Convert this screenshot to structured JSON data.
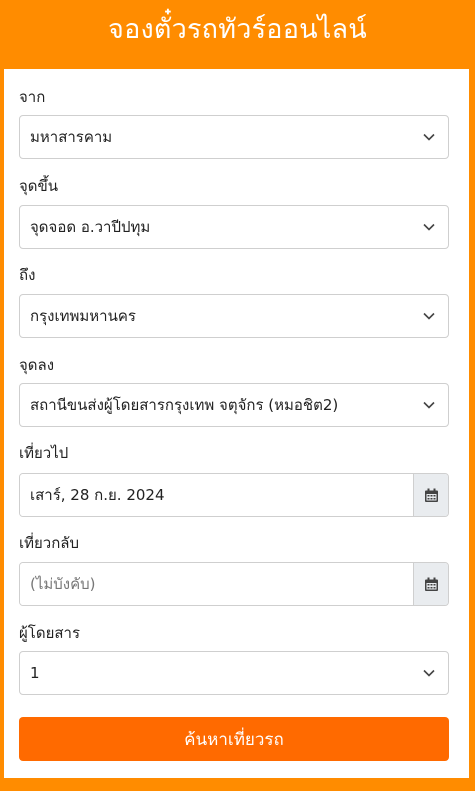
{
  "header": {
    "title": "จองตั๋วรถทัวร์ออนไลน์"
  },
  "form": {
    "origin": {
      "label": "จาก",
      "value": "มหาสารคาม"
    },
    "pickup": {
      "label": "จุดขึ้น",
      "value": "จุดจอด อ.วาปีปทุม"
    },
    "destination": {
      "label": "ถึง",
      "value": "กรุงเทพมหานคร"
    },
    "dropoff": {
      "label": "จุดลง",
      "value": "สถานีขนส่งผู้โดยสารกรุงเทพ จตุจักร (หมอชิต2)"
    },
    "depart": {
      "label": "เที่ยวไป",
      "value": "เสาร์, 28 ก.ย. 2024"
    },
    "return": {
      "label": "เที่ยวกลับ",
      "placeholder": "(ไม่บังคับ)"
    },
    "passengers": {
      "label": "ผู้โดยสาร",
      "value": "1"
    },
    "search_label": "ค้นหาเที่ยวรถ"
  },
  "colors": {
    "background": "#ff8c00",
    "button": "#ff6a00",
    "addon": "#e9ecef"
  },
  "icons": {
    "dropdown": "chevron-down-icon",
    "calendar": "calendar-icon"
  }
}
